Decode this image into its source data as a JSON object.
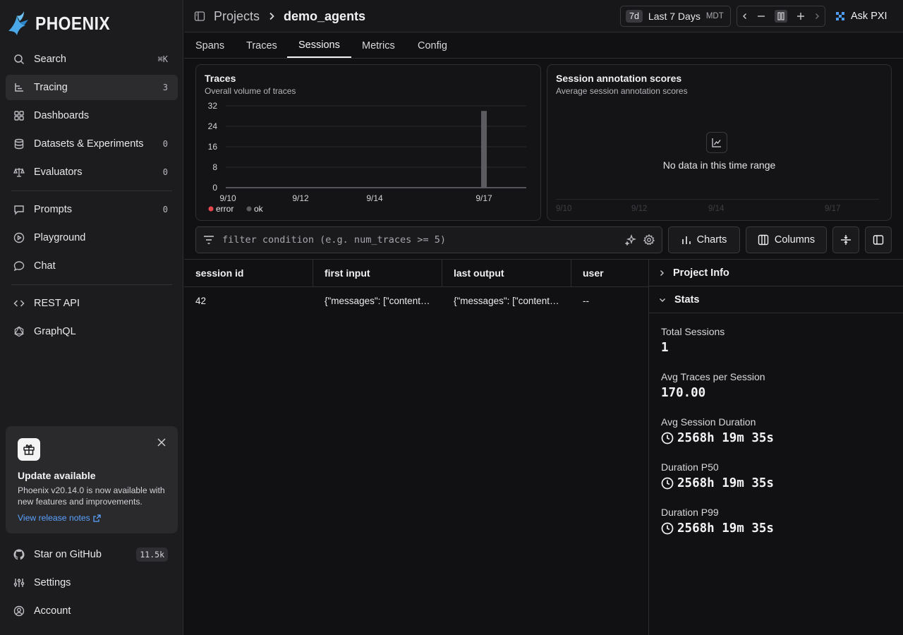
{
  "app": {
    "name": "PHOENIX"
  },
  "sidebar": {
    "items": [
      {
        "label": "Search",
        "shortcut": "⌘K",
        "icon": "search-icon"
      },
      {
        "label": "Tracing",
        "count": "3",
        "icon": "tracing-icon"
      },
      {
        "label": "Dashboards",
        "icon": "dashboards-icon"
      },
      {
        "label": "Datasets & Experiments",
        "count": "0",
        "icon": "database-icon"
      },
      {
        "label": "Evaluators",
        "count": "0",
        "icon": "scale-icon"
      },
      {
        "label": "Prompts",
        "count": "0",
        "icon": "prompt-icon"
      },
      {
        "label": "Playground",
        "icon": "playground-icon"
      },
      {
        "label": "Chat",
        "icon": "chat-icon"
      },
      {
        "label": "REST API",
        "icon": "code-icon"
      },
      {
        "label": "GraphQL",
        "icon": "graphql-icon"
      }
    ],
    "bottom": [
      {
        "label": "Star on GitHub",
        "count": "11.5k",
        "icon": "github-icon"
      },
      {
        "label": "Settings",
        "icon": "settings-icon"
      },
      {
        "label": "Account",
        "icon": "account-icon"
      }
    ]
  },
  "update": {
    "title": "Update available",
    "body": "Phoenix v20.14.0 is now available with new features and improvements.",
    "link": "View release notes"
  },
  "header": {
    "breadcrumb_parent": "Projects",
    "breadcrumb_current": "demo_agents",
    "time_pill": "7d",
    "time_label": "Last 7 Days",
    "timezone": "MDT",
    "ask": "Ask PXI"
  },
  "tabs": [
    "Spans",
    "Traces",
    "Sessions",
    "Metrics",
    "Config"
  ],
  "traces_card": {
    "title": "Traces",
    "subtitle": "Overall volume of traces",
    "legend": [
      "error",
      "ok"
    ]
  },
  "chart_data": {
    "type": "bar",
    "title": "Traces",
    "subtitle": "Overall volume of traces",
    "x_ticks": [
      "9/10",
      "9/12",
      "9/14",
      "9/17"
    ],
    "y_ticks": [
      "0",
      "8",
      "16",
      "24",
      "32"
    ],
    "ylim": [
      0,
      32
    ],
    "series": [
      {
        "name": "error",
        "color": "#e5484d",
        "values": [
          0
        ]
      },
      {
        "name": "ok",
        "color": "#5c5c60",
        "values": [
          30
        ]
      }
    ],
    "bars": [
      {
        "x": "9/17",
        "ok": 30,
        "error": 0
      }
    ],
    "legend": "bottom-left",
    "grid": true
  },
  "annotation_card": {
    "title": "Session annotation scores",
    "subtitle": "Average session annotation scores",
    "empty": "No data in this time range",
    "x_ticks": [
      "9/10",
      "9/12",
      "9/14",
      "9/17"
    ]
  },
  "filter": {
    "placeholder": "filter condition (e.g. num_traces >= 5)"
  },
  "toolbar": {
    "charts": "Charts",
    "columns": "Columns"
  },
  "table": {
    "columns": [
      "session id",
      "first input",
      "last output",
      "user"
    ],
    "rows": [
      [
        "42",
        "{\"messages\": [\"content\": \"…",
        "{\"messages\": [\"content\": \"…",
        "--"
      ]
    ]
  },
  "panel": {
    "project_info": "Project Info",
    "stats_title": "Stats",
    "stats": [
      {
        "label": "Total Sessions",
        "value": "1"
      },
      {
        "label": "Avg Traces per Session",
        "value": "170.00"
      },
      {
        "label": "Avg Session Duration",
        "value": "2568h 19m 35s"
      },
      {
        "label": "Duration P50",
        "value": "2568h 19m 35s"
      },
      {
        "label": "Duration P99",
        "value": "2568h 19m 35s"
      }
    ]
  }
}
